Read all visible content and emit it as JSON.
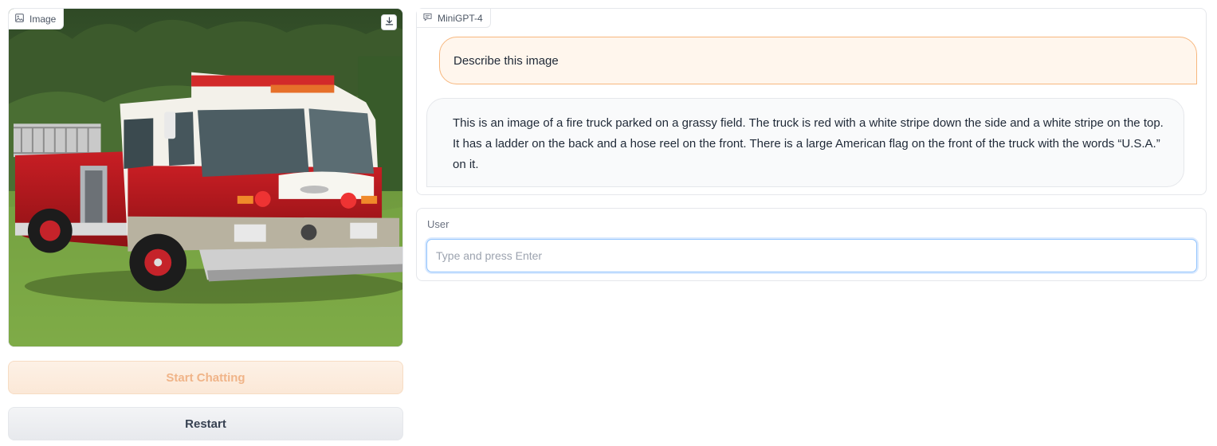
{
  "image_panel": {
    "label": "Image",
    "label_icon": "image-icon",
    "download_icon": "download-icon"
  },
  "buttons": {
    "start_label": "Start Chatting",
    "restart_label": "Restart"
  },
  "chat": {
    "label": "MiniGPT-4",
    "label_icon": "chat-bubble-icon",
    "messages": [
      {
        "role": "user",
        "text": "Describe this image"
      },
      {
        "role": "bot",
        "text": "This is an image of a fire truck parked on a grassy field. The truck is red with a white stripe down the side and a white stripe on the top. It has a ladder on the back and a hose reel on the front. There is a large American flag on the front of the truck with the words “U.S.A.” on it."
      }
    ]
  },
  "user_input": {
    "label": "User",
    "value": "",
    "placeholder": "Type and press Enter"
  },
  "colors": {
    "accent_orange": "#f7b77e",
    "user_bubble_bg": "#fff6ed",
    "input_focus": "#93c5fd"
  }
}
